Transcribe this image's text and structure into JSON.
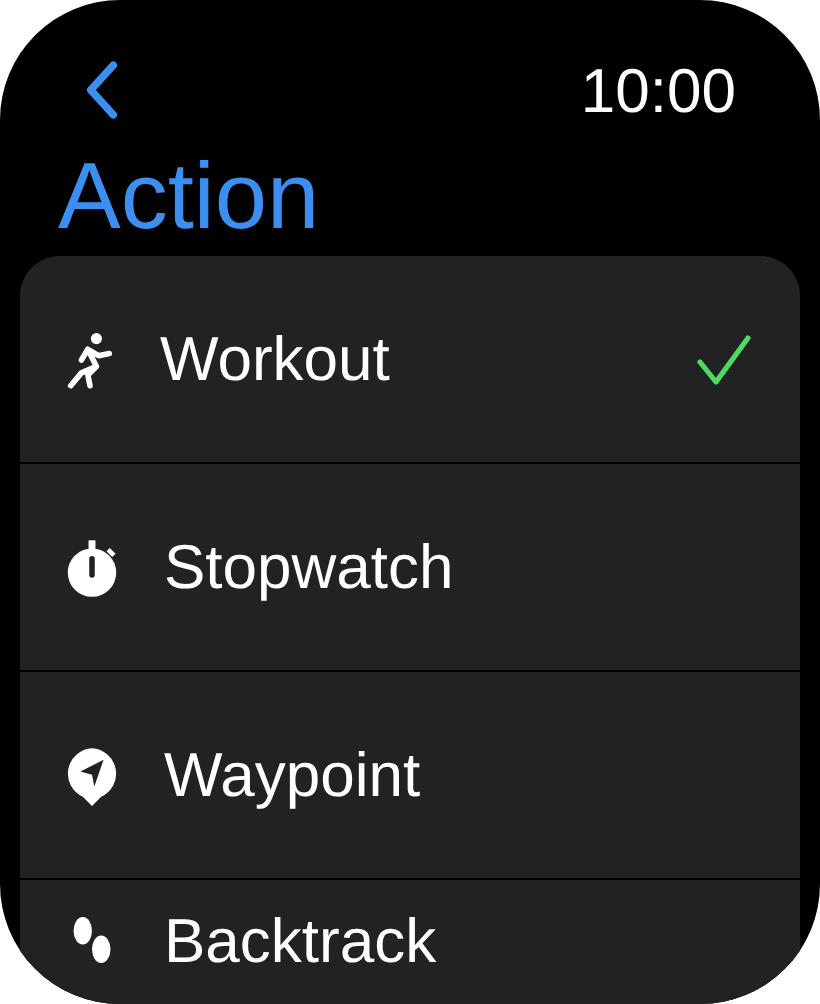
{
  "status_bar": {
    "time": "10:00"
  },
  "title": "Action",
  "items": [
    {
      "label": "Workout",
      "selected": true
    },
    {
      "label": "Stopwatch",
      "selected": false
    },
    {
      "label": "Waypoint",
      "selected": false
    },
    {
      "label": "Backtrack",
      "selected": false
    }
  ]
}
